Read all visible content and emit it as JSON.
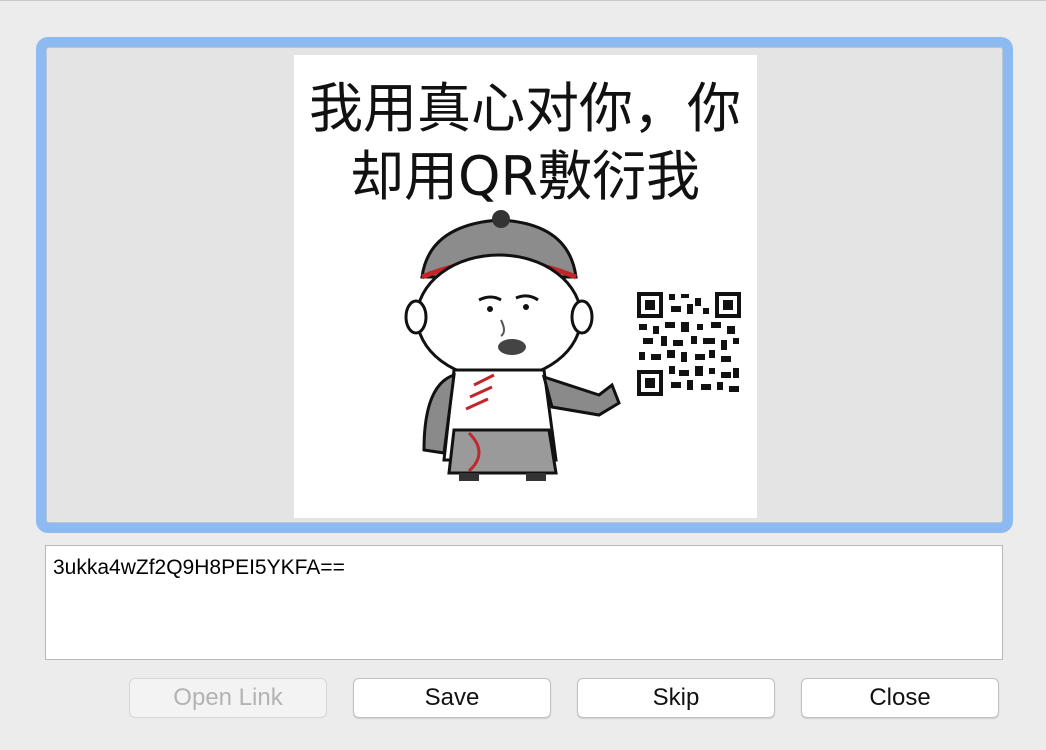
{
  "image_panel": {
    "meme_text_line1": "我用真心对你，你",
    "meme_text_line2": "却用QR敷衍我"
  },
  "result": {
    "text": "3ukka4wZf2Q9H8PEI5YKFA=="
  },
  "buttons": {
    "open_link": "Open Link",
    "save": "Save",
    "skip": "Skip",
    "close": "Close"
  },
  "colors": {
    "focus_ring": "#8dbaf0",
    "well_background": "#e4e4e4"
  },
  "icons": {
    "qr_code": "qr-code-icon"
  }
}
